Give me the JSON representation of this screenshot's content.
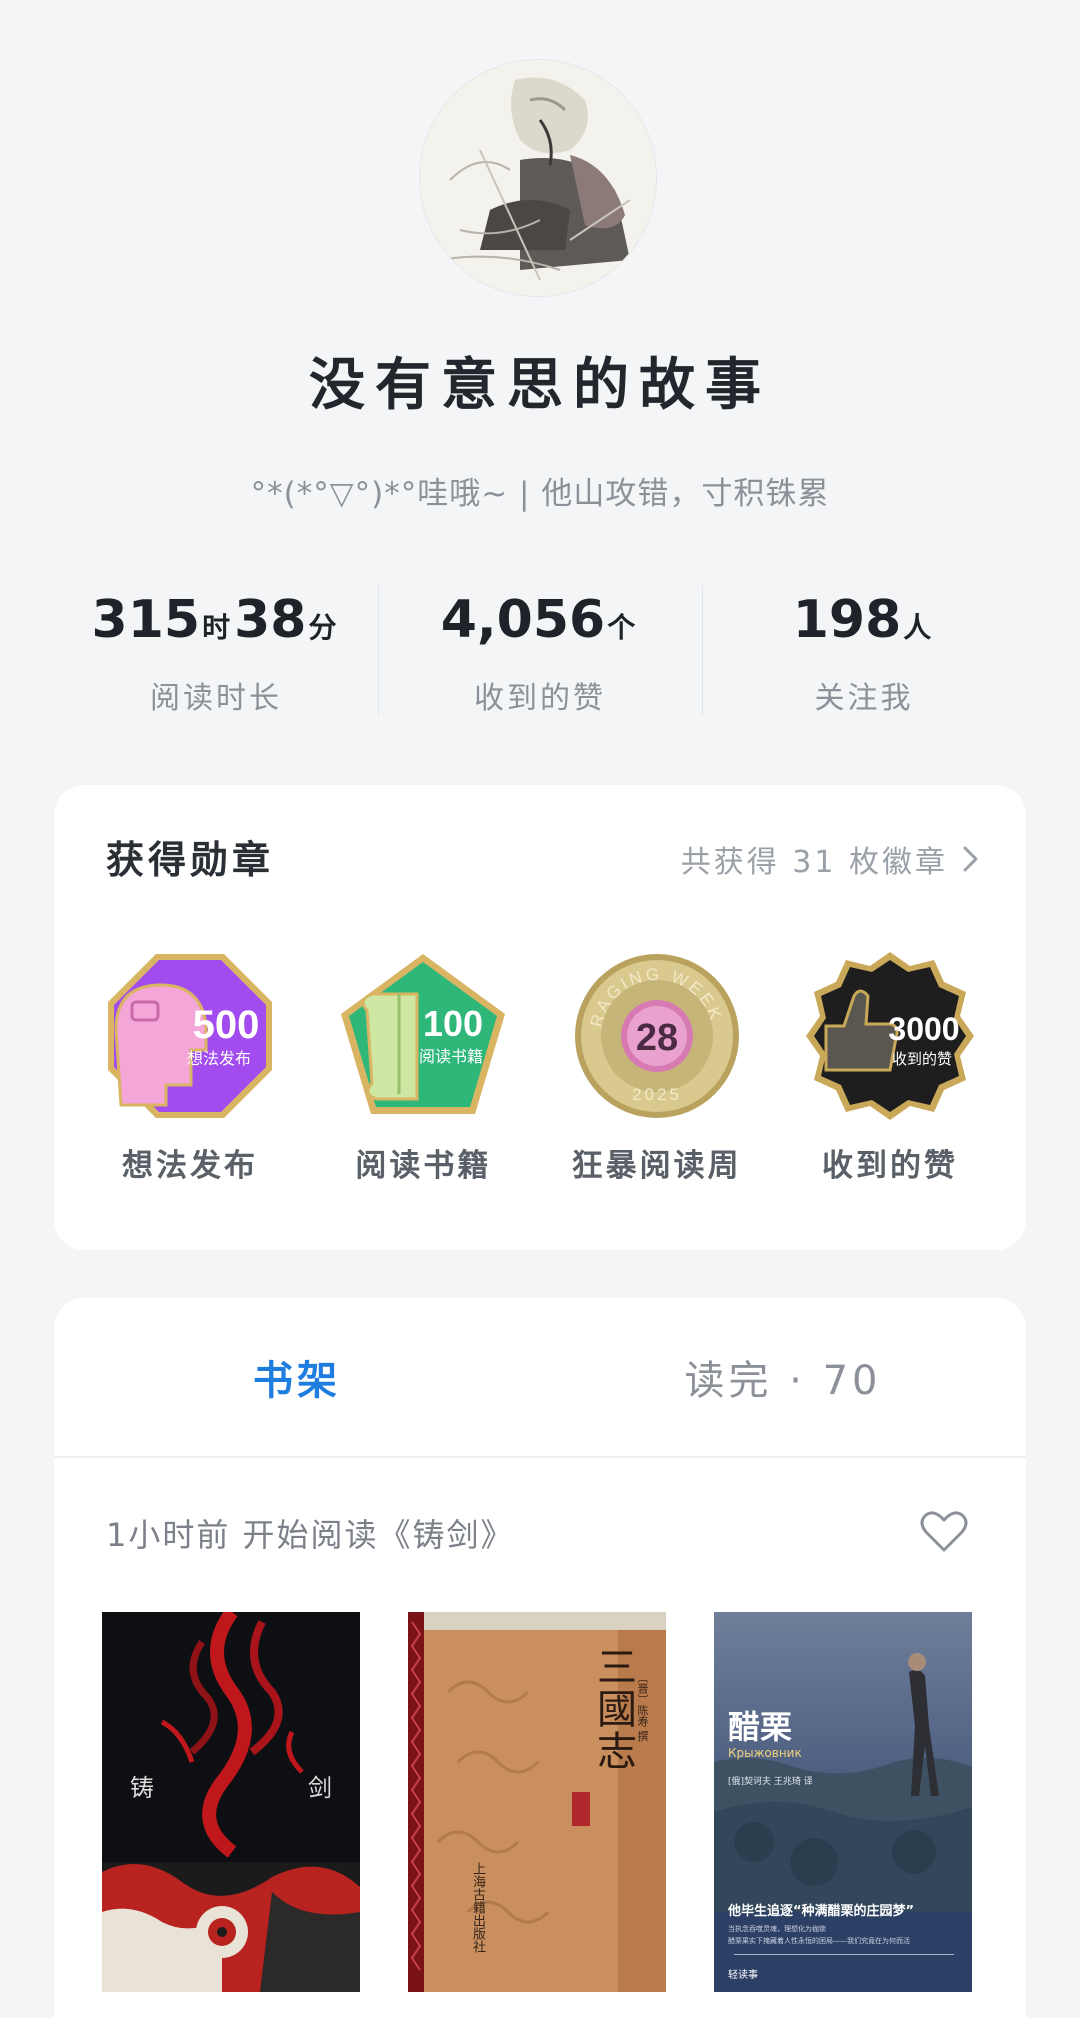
{
  "profile": {
    "nickname": "没有意思的故事",
    "bio": "°*(*°▽°)*°哇哦~ | 他山攻错，寸积铢累"
  },
  "stats": [
    {
      "value1": "315",
      "unit1": "时",
      "value2": "38",
      "unit2": "分",
      "label": "阅读时长"
    },
    {
      "value1": "4,056",
      "unit1": "个",
      "label": "收到的赞"
    },
    {
      "value1": "198",
      "unit1": "人",
      "label": "关注我"
    }
  ],
  "badges": {
    "title": "获得勋章",
    "link_text": "共获得 31 枚徽章",
    "items": [
      {
        "label": "想法发布",
        "number": "500",
        "caption": "想法发布",
        "color": "#a24cf0"
      },
      {
        "label": "阅读书籍",
        "number": "100",
        "caption": "阅读书籍",
        "color": "#2fb77a"
      },
      {
        "label": "狂暴阅读周",
        "number": "28",
        "ring_text": "RAGING WEEK",
        "year": "2025",
        "color": "#c9b26a"
      },
      {
        "label": "收到的赞",
        "number": "3000",
        "caption": "收到的赞",
        "color": "#2b2b2b"
      }
    ]
  },
  "shelf": {
    "tabs": [
      {
        "label": "书架",
        "active": true
      },
      {
        "label": "读完 · 70",
        "active": false
      }
    ],
    "activity": "1小时前  开始阅读《铸剑》",
    "books": [
      {
        "title_left": "铸",
        "title_right": "剑"
      },
      {
        "title": "三國志",
        "publisher": "上海古籍出版社",
        "author": "〔晋〕陈寿 撰"
      },
      {
        "title": "醋栗",
        "subtitle": "Крыжовник",
        "translator": "[俄]契诃夫  王兆琦 译",
        "tagline": "他毕生追逐“种满醋栗的庄园梦”",
        "blurb1": "当执念吞噬灵魂，理想化为枷锁",
        "blurb2": "醋栗果实下掩藏着人性永恒的困局——我们究竟在为何而活",
        "logo": "轻读事"
      }
    ]
  },
  "colors": {
    "accent": "#1f7de0",
    "background": "#f3f5f7",
    "card": "#ffffff"
  }
}
